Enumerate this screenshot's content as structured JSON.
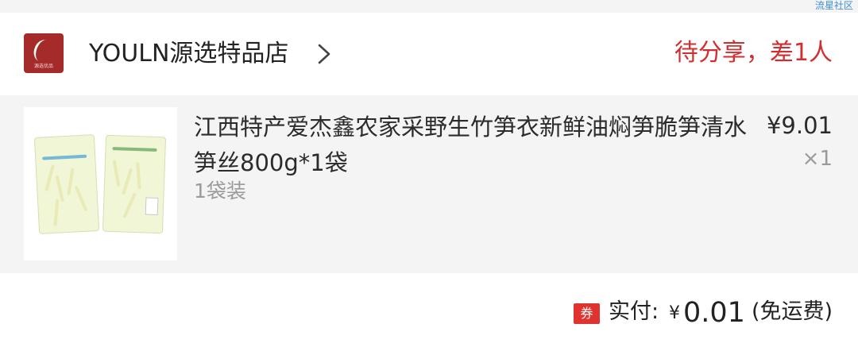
{
  "watermark": "流星社区",
  "shop": {
    "name": "YOULN源选特品店",
    "logo_text": "源选优品",
    "status": "待分享，差1人"
  },
  "product": {
    "title": "江西特产爱杰鑫农家采野生竹笋衣新鲜油焖笋脆笋清水笋丝800g*1袋",
    "variant": "1袋装",
    "price": "¥9.01",
    "quantity": "×1"
  },
  "footer": {
    "coupon_badge": "券",
    "paid_label": "实付:",
    "currency": "¥",
    "amount": "0.01",
    "shipping_note": "(免运费)"
  },
  "colors": {
    "accent": "#d12f2f",
    "coupon": "#e0322f",
    "logo": "#a52a2a",
    "watermark": "#3c8ed8"
  },
  "icons": [
    "shop-logo-icon",
    "chevron-right-icon",
    "coupon-icon"
  ]
}
